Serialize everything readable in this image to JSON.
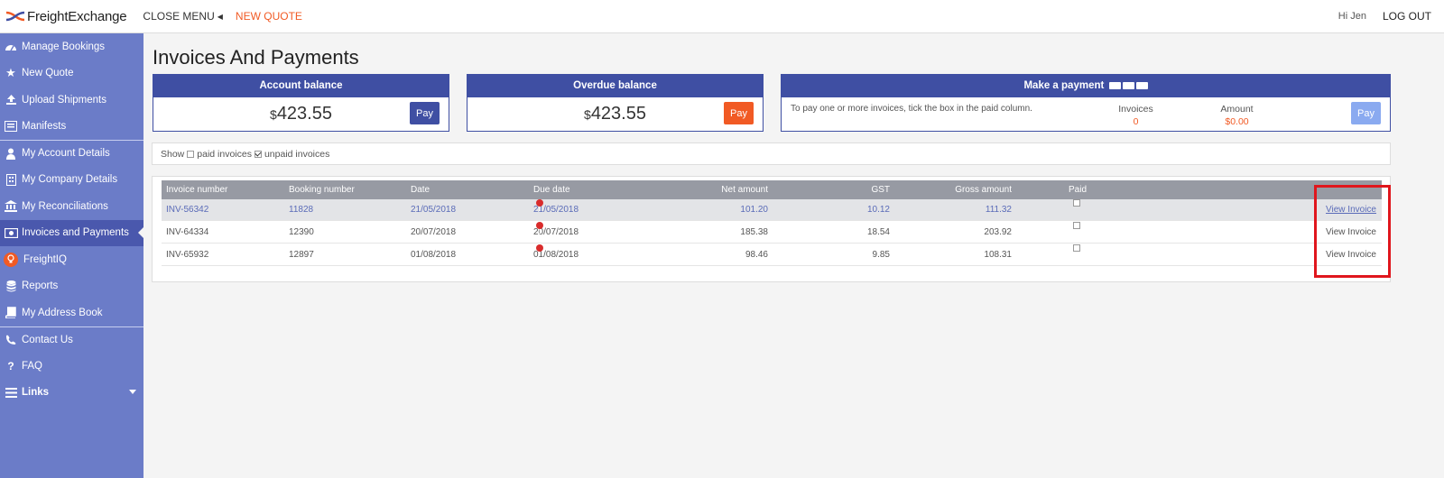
{
  "brand": {
    "name": "FreightExchange"
  },
  "topnav": {
    "close_menu": "CLOSE MENU",
    "new_quote": "NEW QUOTE",
    "greeting": "Hi Jen",
    "logout": "LOG OUT"
  },
  "sidebar": {
    "items": [
      {
        "label": "Manage Bookings",
        "icon": "dashboard-icon"
      },
      {
        "label": "New Quote",
        "icon": "star-icon"
      },
      {
        "label": "Upload Shipments",
        "icon": "upload-icon"
      },
      {
        "label": "Manifests",
        "icon": "list-icon"
      },
      {
        "label": "My Account Details",
        "icon": "user-icon"
      },
      {
        "label": "My Company Details",
        "icon": "building-icon"
      },
      {
        "label": "My Reconciliations",
        "icon": "bank-icon"
      },
      {
        "label": "Invoices and Payments",
        "icon": "money-icon"
      },
      {
        "label": "FreightIQ",
        "icon": "lightbulb-icon"
      },
      {
        "label": "Reports",
        "icon": "database-icon"
      },
      {
        "label": "My Address Book",
        "icon": "book-icon"
      },
      {
        "label": "Contact Us",
        "icon": "phone-icon"
      },
      {
        "label": "FAQ",
        "icon": "question-icon"
      },
      {
        "label": "Links",
        "icon": "menu-icon"
      }
    ]
  },
  "page": {
    "title": "Invoices And Payments"
  },
  "account_balance": {
    "title": "Account balance",
    "currency": "$",
    "amount": "423.55",
    "pay_label": "Pay"
  },
  "overdue_balance": {
    "title": "Overdue balance",
    "currency": "$",
    "amount": "423.55",
    "pay_label": "Pay"
  },
  "make_payment": {
    "title": "Make a payment",
    "instructions": "To pay one or more invoices, tick the box in the paid column.",
    "invoices_label": "Invoices",
    "invoices_value": "0",
    "amount_label": "Amount",
    "amount_value": "$0.00",
    "pay_label": "Pay"
  },
  "filter": {
    "show": "Show",
    "paid": "paid invoices",
    "unpaid": "unpaid invoices",
    "paid_checked": false,
    "unpaid_checked": true
  },
  "table": {
    "headers": {
      "invoice": "Invoice number",
      "booking": "Booking number",
      "date": "Date",
      "due": "Due date",
      "net": "Net amount",
      "gst": "GST",
      "gross": "Gross amount",
      "paid": "Paid"
    },
    "rows": [
      {
        "invoice": "INV-56342",
        "booking": "11828",
        "date": "21/05/2018",
        "due": "21/05/2018",
        "net": "101.20",
        "gst": "10.12",
        "gross": "111.32",
        "view": "View Invoice"
      },
      {
        "invoice": "INV-64334",
        "booking": "12390",
        "date": "20/07/2018",
        "due": "20/07/2018",
        "net": "185.38",
        "gst": "18.54",
        "gross": "203.92",
        "view": "View Invoice"
      },
      {
        "invoice": "INV-65932",
        "booking": "12897",
        "date": "01/08/2018",
        "due": "01/08/2018",
        "net": "98.46",
        "gst": "9.85",
        "gross": "108.31",
        "view": "View Invoice"
      }
    ]
  },
  "colors": {
    "sidebar": "#6b7cc8",
    "sidebar_active": "#4a58ad",
    "card_border": "#3f4fa3",
    "accent_orange": "#f15a24",
    "highlight_red": "#e0161d"
  }
}
